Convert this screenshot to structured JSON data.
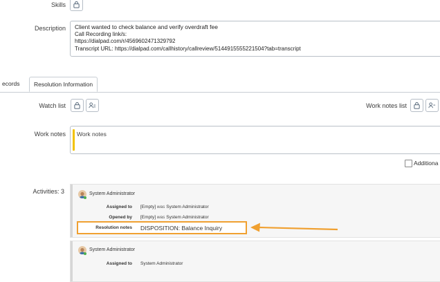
{
  "skills": {
    "label": "Skills"
  },
  "description": {
    "label": "Description",
    "lines": [
      "Client wanted to check balance and verify overdraft fee",
      "Call Recording link/s:",
      "https://dialpad.com/r/4569602471329792",
      "Transcript URL: https://dialpad.com/callhistory/callreview/5144915555221504?tab=transcript"
    ]
  },
  "tabs": [
    {
      "label": "ecords"
    },
    {
      "label": "Resolution Information"
    }
  ],
  "watch_list": {
    "label": "Watch list"
  },
  "work_notes_list": {
    "label": "Work notes list"
  },
  "work_notes": {
    "label": "Work notes",
    "placeholder": "Work notes"
  },
  "additional": {
    "label": "Additiona"
  },
  "activities": {
    "label": "Activities: 3"
  },
  "entries": [
    {
      "user": "System Administrator",
      "fields": [
        {
          "label": "Assigned to",
          "old": "[Empty]",
          "was": "was",
          "new": "System Administrator"
        },
        {
          "label": "Opened by",
          "old": "[Empty]",
          "was": "was",
          "new": "System Administrator"
        },
        {
          "label": "Resolution notes",
          "value": "DISPOSITION: Balance Inquiry"
        }
      ]
    },
    {
      "user": "System Administrator",
      "fields": [
        {
          "label": "Assigned to",
          "value": "System Administrator"
        }
      ]
    }
  ],
  "colors": {
    "highlight": "#f0a030",
    "worknotes_bar": "#f2c200"
  },
  "icons": [
    "lock-icon",
    "add-users-icon",
    "checkbox-icon",
    "avatar-icon",
    "arrow-icon"
  ]
}
